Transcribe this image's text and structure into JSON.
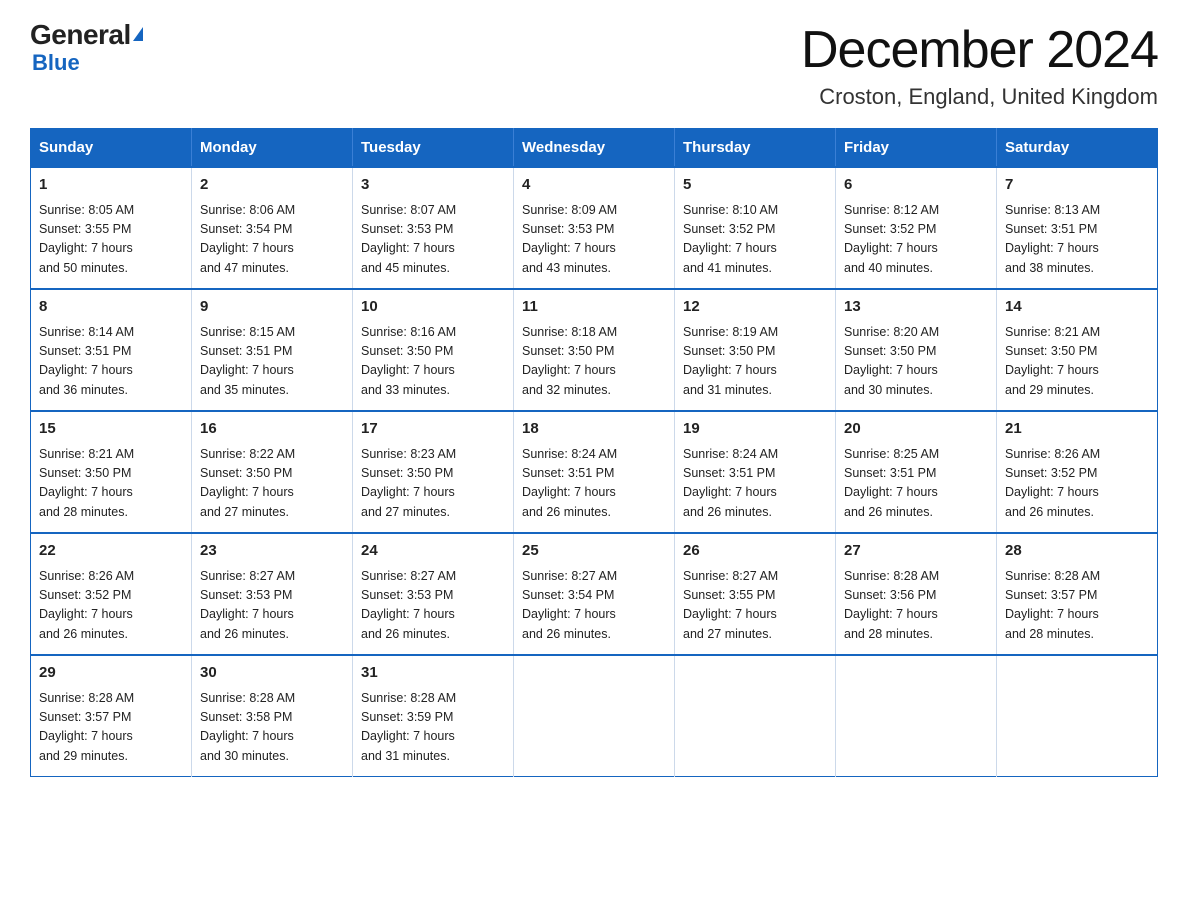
{
  "header": {
    "logo_top": "General",
    "logo_blue": "Blue",
    "title": "December 2024",
    "subtitle": "Croston, England, United Kingdom"
  },
  "days_of_week": [
    "Sunday",
    "Monday",
    "Tuesday",
    "Wednesday",
    "Thursday",
    "Friday",
    "Saturday"
  ],
  "weeks": [
    [
      {
        "day": "1",
        "sunrise": "8:05 AM",
        "sunset": "3:55 PM",
        "daylight": "7 hours and 50 minutes."
      },
      {
        "day": "2",
        "sunrise": "8:06 AM",
        "sunset": "3:54 PM",
        "daylight": "7 hours and 47 minutes."
      },
      {
        "day": "3",
        "sunrise": "8:07 AM",
        "sunset": "3:53 PM",
        "daylight": "7 hours and 45 minutes."
      },
      {
        "day": "4",
        "sunrise": "8:09 AM",
        "sunset": "3:53 PM",
        "daylight": "7 hours and 43 minutes."
      },
      {
        "day": "5",
        "sunrise": "8:10 AM",
        "sunset": "3:52 PM",
        "daylight": "7 hours and 41 minutes."
      },
      {
        "day": "6",
        "sunrise": "8:12 AM",
        "sunset": "3:52 PM",
        "daylight": "7 hours and 40 minutes."
      },
      {
        "day": "7",
        "sunrise": "8:13 AM",
        "sunset": "3:51 PM",
        "daylight": "7 hours and 38 minutes."
      }
    ],
    [
      {
        "day": "8",
        "sunrise": "8:14 AM",
        "sunset": "3:51 PM",
        "daylight": "7 hours and 36 minutes."
      },
      {
        "day": "9",
        "sunrise": "8:15 AM",
        "sunset": "3:51 PM",
        "daylight": "7 hours and 35 minutes."
      },
      {
        "day": "10",
        "sunrise": "8:16 AM",
        "sunset": "3:50 PM",
        "daylight": "7 hours and 33 minutes."
      },
      {
        "day": "11",
        "sunrise": "8:18 AM",
        "sunset": "3:50 PM",
        "daylight": "7 hours and 32 minutes."
      },
      {
        "day": "12",
        "sunrise": "8:19 AM",
        "sunset": "3:50 PM",
        "daylight": "7 hours and 31 minutes."
      },
      {
        "day": "13",
        "sunrise": "8:20 AM",
        "sunset": "3:50 PM",
        "daylight": "7 hours and 30 minutes."
      },
      {
        "day": "14",
        "sunrise": "8:21 AM",
        "sunset": "3:50 PM",
        "daylight": "7 hours and 29 minutes."
      }
    ],
    [
      {
        "day": "15",
        "sunrise": "8:21 AM",
        "sunset": "3:50 PM",
        "daylight": "7 hours and 28 minutes."
      },
      {
        "day": "16",
        "sunrise": "8:22 AM",
        "sunset": "3:50 PM",
        "daylight": "7 hours and 27 minutes."
      },
      {
        "day": "17",
        "sunrise": "8:23 AM",
        "sunset": "3:50 PM",
        "daylight": "7 hours and 27 minutes."
      },
      {
        "day": "18",
        "sunrise": "8:24 AM",
        "sunset": "3:51 PM",
        "daylight": "7 hours and 26 minutes."
      },
      {
        "day": "19",
        "sunrise": "8:24 AM",
        "sunset": "3:51 PM",
        "daylight": "7 hours and 26 minutes."
      },
      {
        "day": "20",
        "sunrise": "8:25 AM",
        "sunset": "3:51 PM",
        "daylight": "7 hours and 26 minutes."
      },
      {
        "day": "21",
        "sunrise": "8:26 AM",
        "sunset": "3:52 PM",
        "daylight": "7 hours and 26 minutes."
      }
    ],
    [
      {
        "day": "22",
        "sunrise": "8:26 AM",
        "sunset": "3:52 PM",
        "daylight": "7 hours and 26 minutes."
      },
      {
        "day": "23",
        "sunrise": "8:27 AM",
        "sunset": "3:53 PM",
        "daylight": "7 hours and 26 minutes."
      },
      {
        "day": "24",
        "sunrise": "8:27 AM",
        "sunset": "3:53 PM",
        "daylight": "7 hours and 26 minutes."
      },
      {
        "day": "25",
        "sunrise": "8:27 AM",
        "sunset": "3:54 PM",
        "daylight": "7 hours and 26 minutes."
      },
      {
        "day": "26",
        "sunrise": "8:27 AM",
        "sunset": "3:55 PM",
        "daylight": "7 hours and 27 minutes."
      },
      {
        "day": "27",
        "sunrise": "8:28 AM",
        "sunset": "3:56 PM",
        "daylight": "7 hours and 28 minutes."
      },
      {
        "day": "28",
        "sunrise": "8:28 AM",
        "sunset": "3:57 PM",
        "daylight": "7 hours and 28 minutes."
      }
    ],
    [
      {
        "day": "29",
        "sunrise": "8:28 AM",
        "sunset": "3:57 PM",
        "daylight": "7 hours and 29 minutes."
      },
      {
        "day": "30",
        "sunrise": "8:28 AM",
        "sunset": "3:58 PM",
        "daylight": "7 hours and 30 minutes."
      },
      {
        "day": "31",
        "sunrise": "8:28 AM",
        "sunset": "3:59 PM",
        "daylight": "7 hours and 31 minutes."
      },
      null,
      null,
      null,
      null
    ]
  ],
  "labels": {
    "sunrise": "Sunrise:",
    "sunset": "Sunset:",
    "daylight": "Daylight:"
  }
}
